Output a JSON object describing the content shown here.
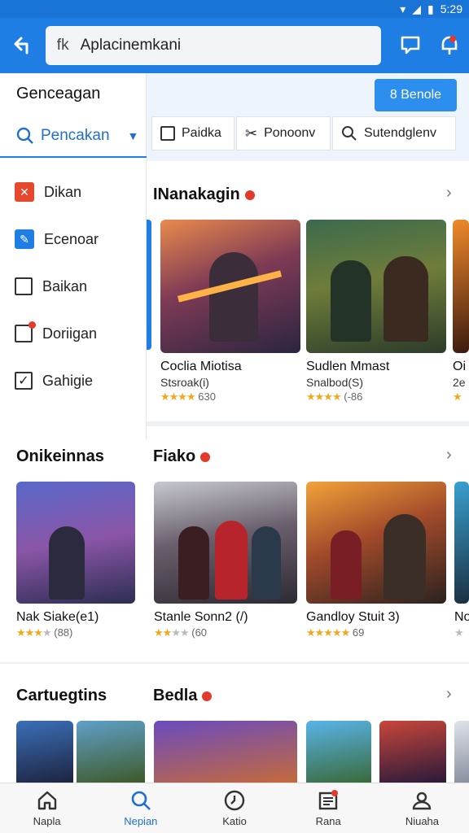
{
  "status_bar": {
    "time": "5:29"
  },
  "app_bar": {
    "search_text": "Aplacinemkani",
    "search_prefix": "fk"
  },
  "sidebar": {
    "title": "Genceagan",
    "search_label": "Pencakan",
    "items": [
      {
        "label": "Dikan",
        "icon": "flag-icon"
      },
      {
        "label": "Ecenoar",
        "icon": "edit-icon"
      },
      {
        "label": "Baikan",
        "icon": "box-icon"
      },
      {
        "label": "Doriigan",
        "icon": "notification-box-icon"
      },
      {
        "label": "Gahigie",
        "icon": "checkbox-icon"
      }
    ]
  },
  "toolbar": {
    "primary_button": "8 Benole",
    "filters": [
      {
        "label": "Paidka",
        "icon": "checkbox-icon"
      },
      {
        "label": "Ponoonv",
        "icon": "tools-icon"
      },
      {
        "label": "Sutendglenv",
        "icon": "search-icon"
      }
    ]
  },
  "sections": [
    {
      "title": "INanakagin",
      "cards": [
        {
          "title": "Coclia Miotisa",
          "subtitle": "Stsroak(i)",
          "rating_text": "630",
          "stars": 4
        },
        {
          "title": "Sudlen Mmast",
          "subtitle": "Snalbod(S)",
          "rating_text": "(-86",
          "stars": 4
        },
        {
          "title": "Oi",
          "subtitle": "2e",
          "rating_text": "",
          "stars": 1
        }
      ]
    },
    {
      "title": "Fiako",
      "cards": [
        {
          "title": "Stanle Sonn2 (/)",
          "subtitle": "",
          "rating_text": "(60",
          "stars": 2
        },
        {
          "title": "Gandloy Stuit 3)",
          "subtitle": "",
          "rating_text": "69",
          "stars": 5
        },
        {
          "title": "No",
          "subtitle": "",
          "rating_text": "",
          "stars": 1
        }
      ]
    },
    {
      "title": "Bedla",
      "cards": []
    }
  ],
  "left_sections": [
    {
      "title": "Onikeinnas",
      "card": {
        "title": "Nak Siake(e1)",
        "rating_text": "(88)",
        "stars": 3
      }
    },
    {
      "title": "Cartuegtins"
    }
  ],
  "bottom_nav": [
    {
      "label": "Napla",
      "icon": "home-icon"
    },
    {
      "label": "Nepian",
      "icon": "search-icon"
    },
    {
      "label": "Katio",
      "icon": "clock-icon"
    },
    {
      "label": "Rana",
      "icon": "news-icon"
    },
    {
      "label": "Niuaha",
      "icon": "profile-icon"
    }
  ],
  "colors": {
    "accent": "#1e7ee3",
    "primary_button": "#2c8ff0",
    "star": "#f2a81d",
    "hot": "#e23a2b"
  }
}
